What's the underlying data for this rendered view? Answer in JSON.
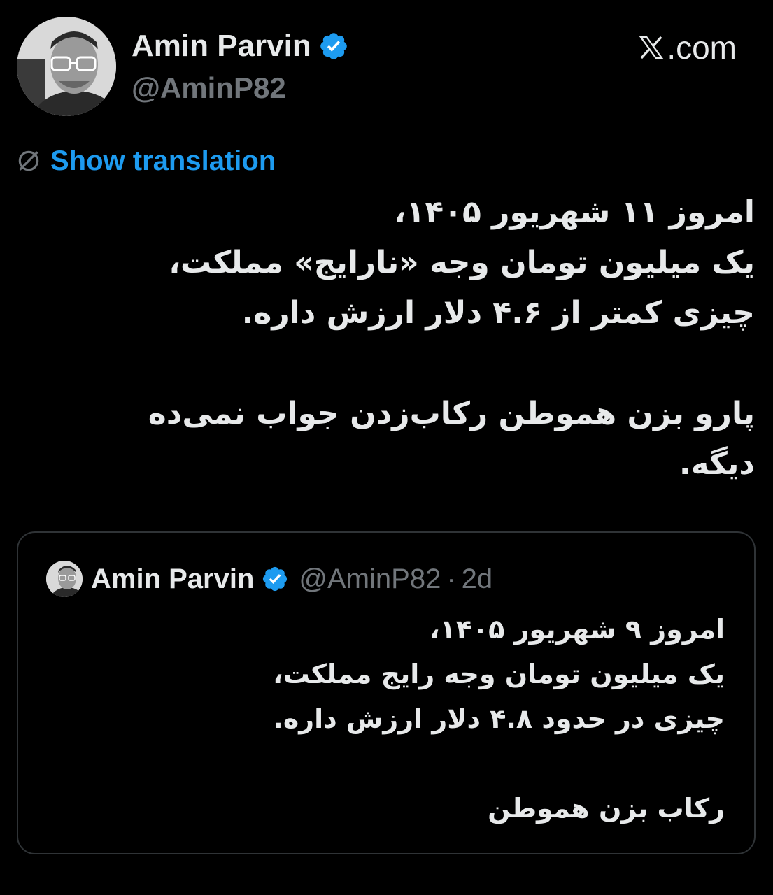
{
  "header": {
    "avatar_icon": "profile-photo",
    "display_name": "Amin Parvin",
    "verified_icon": "verified-badge-icon",
    "verified_color": "#1d9bf0",
    "handle": "@AminP82",
    "site": ".com",
    "site_icon": "x-logo-icon"
  },
  "translation": {
    "icon": "globe-icon",
    "label": "Show translation",
    "color": "#1d9bf0"
  },
  "tweet": {
    "text": "امروز ۱۱ شهریور ۱۴۰۵،\nیک میلیون تومان وجه «نارایج» مملکت،\nچیزی کمتر از ۴.۶ دلار ارزش داره.\n\nپارو بزن هموطن رکاب‌زدن جواب نمی‌ده\nدیگه."
  },
  "quote": {
    "display_name": "Amin Parvin",
    "handle": "@AminP82",
    "separator": "·",
    "time": "2d",
    "text": "امروز ۹ شهریور ۱۴۰۵،\nیک میلیون تومان وجه رایج مملکت،\nچیزی در حدود ۴.۸ دلار ارزش داره.\n\nرکاب بزن هموطن"
  },
  "colors": {
    "background": "#000000",
    "text_primary": "#e7e9ea",
    "text_secondary": "#71767b",
    "border": "#2f3336"
  }
}
